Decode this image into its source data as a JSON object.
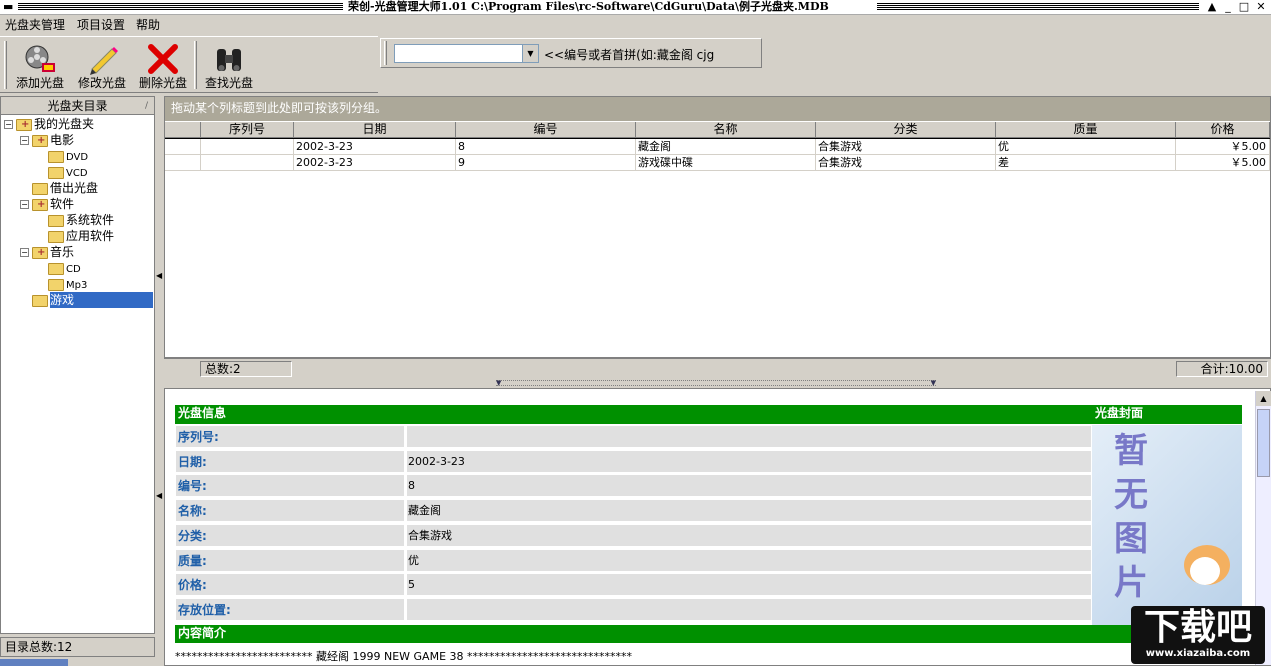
{
  "window": {
    "title": "荣创-光盘管理大师1.01 C:\\Program Files\\rc-Software\\CdGuru\\Data\\例子光盘夹.MDB",
    "system_menu_icon": "dash-icon",
    "minimize_glyph": "_",
    "maximize_glyph": "□",
    "close_glyph": "✕",
    "restore_glyph": "▲"
  },
  "menu": [
    "光盘夹管理",
    "项目设置",
    "帮助"
  ],
  "toolbar": {
    "add_label": "添加光盘",
    "edit_label": "修改光盘",
    "delete_label": "删除光盘",
    "find_label": "查找光盘"
  },
  "search": {
    "value": "",
    "hint": "<<编号或者首拼(如:藏金阁  cjg"
  },
  "tree": {
    "header": "光盘夹目录",
    "nodes": {
      "root": "我的光盘夹",
      "movie": "电影",
      "dvd": "DVD",
      "vcd": "VCD",
      "lent": "借出光盘",
      "software": "软件",
      "system_sw": "系统软件",
      "app_sw": "应用软件",
      "music": "音乐",
      "cd": "CD",
      "mp3": "Mp3",
      "games": "游戏"
    },
    "status": "目录总数:12"
  },
  "grid": {
    "group_hint": "拖动某个列标题到此处即可按该列分组。",
    "columns": [
      "序列号",
      "日期",
      "编号",
      "名称",
      "分类",
      "质量",
      "价格"
    ],
    "rows": [
      [
        "",
        "2002-3-23",
        "8",
        "藏金阁",
        "合集游戏",
        "优",
        "￥5.00"
      ],
      [
        "",
        "2002-3-23",
        "9",
        "游戏碟中碟",
        "合集游戏",
        "差",
        "￥5.00"
      ]
    ],
    "count_label": "总数:2",
    "total_label": "合计:10.00"
  },
  "detail": {
    "info_header": "光盘信息",
    "cover_header": "光盘封面",
    "fields": [
      {
        "label": "序列号:",
        "value": ""
      },
      {
        "label": "日期:",
        "value": "2002-3-23"
      },
      {
        "label": "编号:",
        "value": "8"
      },
      {
        "label": "名称:",
        "value": "藏金阁"
      },
      {
        "label": "分类:",
        "value": "合集游戏"
      },
      {
        "label": "质量:",
        "value": "优"
      },
      {
        "label": "价格:",
        "value": "5"
      },
      {
        "label": "存放位置:",
        "value": ""
      }
    ],
    "cover_text": [
      "暂",
      "无",
      "图",
      "片"
    ],
    "desc_header": "内容简介",
    "desc_text": "************************* 藏经阁 1999 NEW GAME 38 ******************************"
  },
  "watermark": {
    "main": "下载吧",
    "url": "www.xiazaiba.com"
  },
  "colors": {
    "group_header_green": "#009000",
    "selection_blue": "#316ac5",
    "label_blue": "#1f5fa8",
    "grid_group_bar": "#aca899"
  }
}
